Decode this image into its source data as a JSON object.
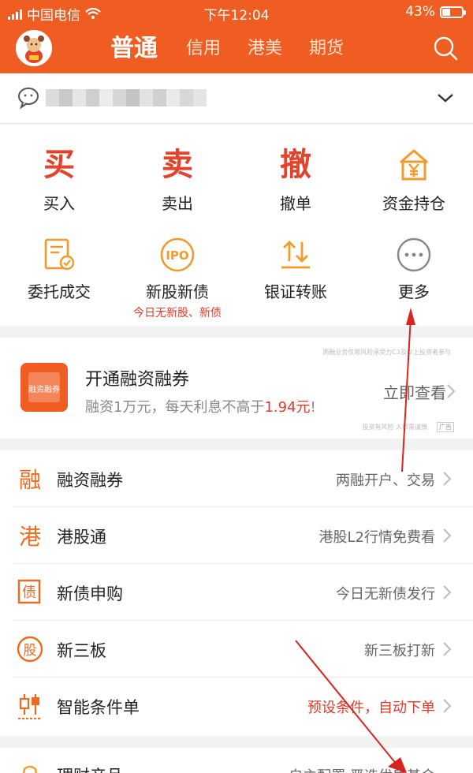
{
  "status_bar": {
    "carrier": "中国电信",
    "time": "下午12:04",
    "battery": "43%",
    "battery_level": 0.43
  },
  "header": {
    "tabs": [
      {
        "label": "普通",
        "active": true
      },
      {
        "label": "信用",
        "active": false
      },
      {
        "label": "港美",
        "active": false
      },
      {
        "label": "期货",
        "active": false
      }
    ]
  },
  "quick_actions": [
    {
      "glyph": "买",
      "label": "买入"
    },
    {
      "glyph": "卖",
      "label": "卖出"
    },
    {
      "glyph": "撤",
      "label": "撤单"
    },
    {
      "icon": "money-bag-icon",
      "label": "资金持仓"
    }
  ],
  "more_actions": [
    {
      "icon": "order-doc-icon",
      "label": "委托成交"
    },
    {
      "icon": "ipo-icon",
      "label": "新股新债",
      "sub": "今日无新股、新债"
    },
    {
      "icon": "transfer-icon",
      "label": "银证转账"
    },
    {
      "icon": "more-icon",
      "label": "更多"
    }
  ],
  "ipo_icon_text": "IPO",
  "banner": {
    "title": "开通融资融券",
    "desc_prefix": "融资1万元，每天利息不高于",
    "desc_highlight": "1.94元",
    "desc_suffix": "!",
    "cta": "立即查看",
    "ad_label": "广告",
    "top_note": "两融业务仅限风险承受力C3及以上投资者参与",
    "bottom_note": "投资有风险 入市需谨慎",
    "badge": "融资融券"
  },
  "menu": [
    {
      "icon": "margin-icon",
      "glyph": "融",
      "label": "融资融券",
      "value": "两融开户、交易",
      "red": false
    },
    {
      "icon": "hk-connect-icon",
      "glyph": "港",
      "label": "港股通",
      "value": "港股L2行情免费看",
      "red": false
    },
    {
      "icon": "bond-icon",
      "glyph": "债",
      "label": "新债申购",
      "value": "今日无新债发行",
      "red": false
    },
    {
      "icon": "neeq-icon",
      "glyph": "股",
      "label": "新三板",
      "value": "新三板打新",
      "red": false
    },
    {
      "icon": "condition-order-icon",
      "glyph": "",
      "label": "智能条件单",
      "value": "预设条件，自动下单",
      "red": true
    }
  ],
  "menu2": {
    "label": "理财产品",
    "value": "自主配置 严选优质基金"
  },
  "colors": {
    "brand": "#f05d22",
    "accent_red": "#e2432a",
    "orange_icon": "#f39a2b"
  }
}
